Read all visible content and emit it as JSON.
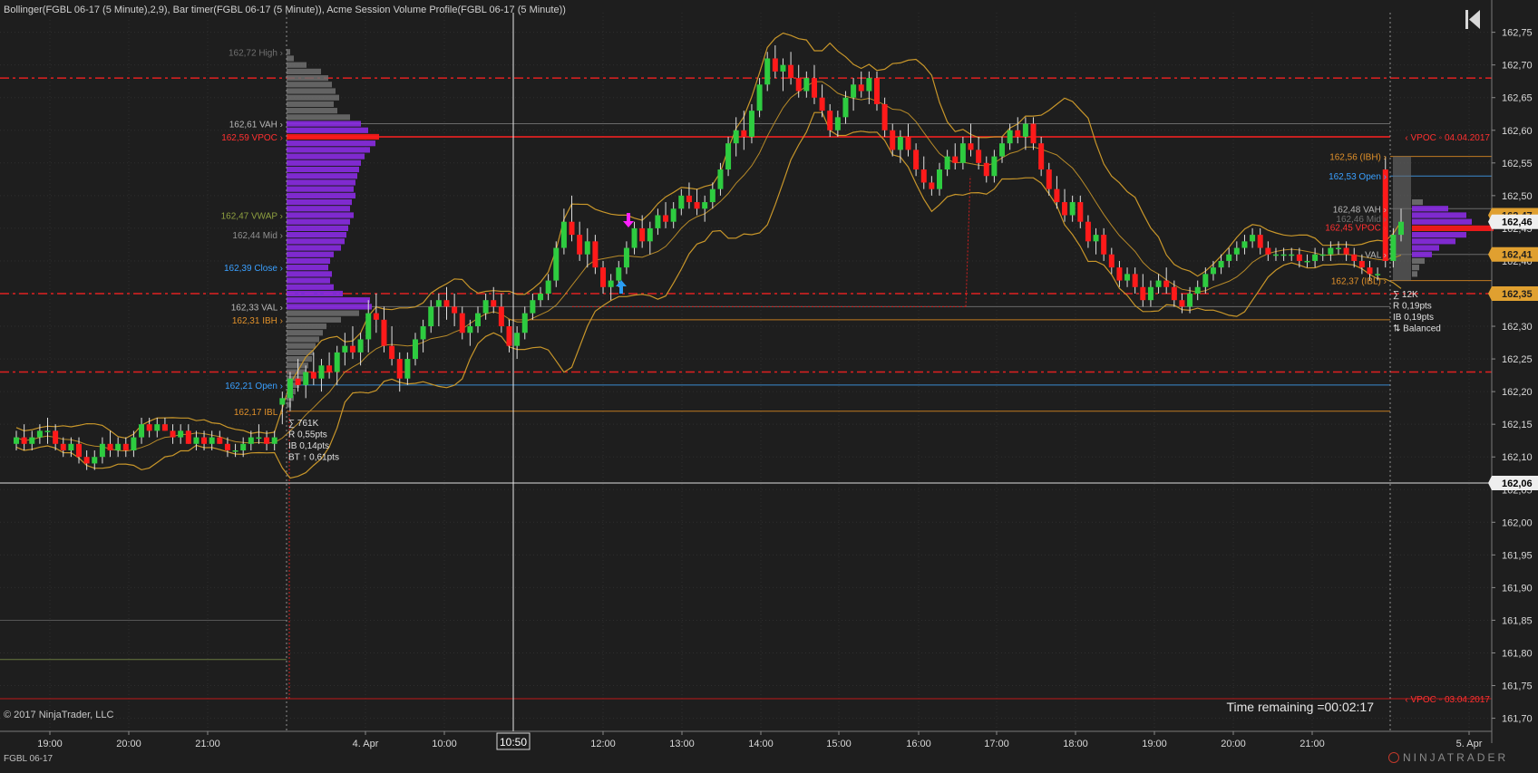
{
  "header": {
    "indicators_label": "Bollinger(FGBL 06-17 (5 Minute),2,9), Bar timer(FGBL 06-17 (5 Minute)), Acme Session Volume Profile(FGBL 06-17 (5 Minute))"
  },
  "status_bar": {
    "instrument": "FGBL 06-17",
    "brand": "NINJATRADER"
  },
  "copyright": "© 2017 NinjaTrader, LLC",
  "timer": "Time remaining =00:02:17",
  "colors": {
    "background": "#1e1e1e",
    "up": "#2ecc40",
    "down": "#ff1a1a",
    "band": "#c8962a",
    "profile": "#8a2be2",
    "poc": "#ff1a1a",
    "open": "#3aa0ff",
    "ib": "#e0902a",
    "vwap": "#8fa040"
  },
  "chart_data": {
    "type": "candlestick",
    "instrument": "FGBL 06-17",
    "timeframe": "5 Minute",
    "y_axis": {
      "min": 161.68,
      "max": 162.78,
      "ticks": [
        "162,75",
        "162,70",
        "162,65",
        "162,60",
        "162,55",
        "162,50",
        "162,45",
        "162,40",
        "162,35",
        "162,30",
        "162,25",
        "162,20",
        "162,15",
        "162,10",
        "162,05",
        "162,00",
        "161,95",
        "161,90",
        "161,85",
        "161,80",
        "161,75",
        "161,70"
      ]
    },
    "x_axis": {
      "labels": [
        "19:00",
        "20:00",
        "21:00",
        "4. Apr",
        "10:00",
        "12:00",
        "13:00",
        "14:00",
        "15:00",
        "16:00",
        "17:00",
        "18:00",
        "19:00",
        "20:00",
        "21:00",
        "5. Apr"
      ],
      "crosshair_label": "10:50"
    },
    "price_badges": [
      {
        "value": "162,47",
        "price": 162.47,
        "color": "#e0a030",
        "text_color": "#1e1e1e"
      },
      {
        "value": "162,46",
        "price": 162.46,
        "color": "#eeeeee",
        "text_color": "#000000"
      },
      {
        "value": "162,41",
        "price": 162.41,
        "color": "#e0a030",
        "text_color": "#1e1e1e"
      },
      {
        "value": "162,35",
        "price": 162.35,
        "color": "#e0a030",
        "text_color": "#1e1e1e"
      },
      {
        "value": "162,06",
        "price": 162.06,
        "color": "#eeeeee",
        "text_color": "#000000"
      }
    ],
    "profile_labels_prev": [
      {
        "text": "162,72 High",
        "price": 162.72,
        "color": "#707070"
      },
      {
        "text": "162,61 VAH",
        "price": 162.61,
        "color": "#b8b8b8"
      },
      {
        "text": "162,59 VPOC",
        "price": 162.59,
        "color": "#ff3030"
      },
      {
        "text": "162,47 VWAP",
        "price": 162.47,
        "color": "#8fa040"
      },
      {
        "text": "162,44 Mid",
        "price": 162.44,
        "color": "#909090"
      },
      {
        "text": "162,39 Close",
        "price": 162.39,
        "color": "#3aa0ff"
      },
      {
        "text": "162,33 VAL",
        "price": 162.33,
        "color": "#b8b8b8"
      },
      {
        "text": "162,31 IBH",
        "price": 162.31,
        "color": "#e0902a"
      },
      {
        "text": "162,21 Open",
        "price": 162.21,
        "color": "#3aa0ff"
      },
      {
        "text": "162,17 IBL",
        "price": 162.17,
        "color": "#e0902a"
      }
    ],
    "profile_labels_cur": [
      {
        "text": "162,56 (IBH)",
        "price": 162.56,
        "color": "#e0902a"
      },
      {
        "text": "162,53 Open",
        "price": 162.53,
        "color": "#3aa0ff"
      },
      {
        "text": "162,48 VAH",
        "price": 162.48,
        "color": "#b8b8b8"
      },
      {
        "text": "162,46 Mid",
        "price": 162.465,
        "color": "#707070"
      },
      {
        "text": "162,45 VPOC",
        "price": 162.452,
        "color": "#ff3030"
      },
      {
        "text": "VAL",
        "price": 162.41,
        "color": "#b8b8b8"
      },
      {
        "text": "162,37 (IBL)",
        "price": 162.37,
        "color": "#e0902a"
      }
    ],
    "vpoc_labels": [
      {
        "text": "‹ VPOC ◦ 04.04.2017",
        "price": 162.59
      },
      {
        "text": "‹ VPOC ◦ 03.04.2017",
        "price": 161.73
      }
    ],
    "session_stats_prev": [
      "∑ 761K",
      "R 0,55pts",
      "IB 0,14pts",
      "BT ↑ 0,61pts"
    ],
    "session_stats_cur": [
      "∑ 12K",
      "R 0,19pts",
      "IB 0,19pts",
      "⇅ Balanced"
    ],
    "dashed_levels": [
      162.68,
      162.35,
      162.23
    ],
    "candles": [
      [
        162.12,
        162.14,
        162.11,
        162.13
      ],
      [
        162.13,
        162.15,
        162.11,
        162.12
      ],
      [
        162.12,
        162.14,
        162.11,
        162.13
      ],
      [
        162.13,
        162.15,
        162.12,
        162.14
      ],
      [
        162.14,
        162.16,
        162.12,
        162.14
      ],
      [
        162.14,
        162.15,
        162.11,
        162.12
      ],
      [
        162.12,
        162.13,
        162.1,
        162.11
      ],
      [
        162.11,
        162.13,
        162.1,
        162.12
      ],
      [
        162.12,
        162.13,
        162.09,
        162.1
      ],
      [
        162.1,
        162.11,
        162.08,
        162.09
      ],
      [
        162.09,
        162.11,
        162.08,
        162.1
      ],
      [
        162.1,
        162.13,
        162.09,
        162.12
      ],
      [
        162.12,
        162.14,
        162.1,
        162.11
      ],
      [
        162.11,
        162.13,
        162.1,
        162.12
      ],
      [
        162.12,
        162.13,
        162.1,
        162.11
      ],
      [
        162.11,
        162.14,
        162.1,
        162.13
      ],
      [
        162.13,
        162.16,
        162.12,
        162.15
      ],
      [
        162.15,
        162.16,
        162.13,
        162.14
      ],
      [
        162.14,
        162.16,
        162.13,
        162.15
      ],
      [
        162.15,
        162.16,
        162.14,
        162.14
      ],
      [
        162.14,
        162.15,
        162.12,
        162.13
      ],
      [
        162.13,
        162.15,
        162.12,
        162.14
      ],
      [
        162.14,
        162.15,
        162.12,
        162.12
      ],
      [
        162.12,
        162.14,
        162.11,
        162.13
      ],
      [
        162.13,
        162.14,
        162.11,
        162.12
      ],
      [
        162.12,
        162.14,
        162.11,
        162.13
      ],
      [
        162.13,
        162.14,
        162.12,
        162.12
      ],
      [
        162.12,
        162.13,
        162.1,
        162.11
      ],
      [
        162.11,
        162.12,
        162.1,
        162.11
      ],
      [
        162.11,
        162.13,
        162.1,
        162.12
      ],
      [
        162.12,
        162.14,
        162.11,
        162.13
      ],
      [
        162.13,
        162.15,
        162.12,
        162.13
      ],
      [
        162.13,
        162.14,
        162.11,
        162.12
      ],
      [
        162.12,
        162.14,
        162.11,
        162.13
      ],
      [
        162.18,
        162.2,
        162.15,
        162.19
      ],
      [
        162.19,
        162.23,
        162.17,
        162.22
      ],
      [
        162.22,
        162.25,
        162.2,
        162.21
      ],
      [
        162.21,
        162.24,
        162.19,
        162.23
      ],
      [
        162.23,
        162.26,
        162.21,
        162.22
      ],
      [
        162.22,
        162.25,
        162.2,
        162.24
      ],
      [
        162.24,
        162.26,
        162.22,
        162.23
      ],
      [
        162.23,
        162.27,
        162.21,
        162.26
      ],
      [
        162.26,
        162.29,
        162.24,
        162.27
      ],
      [
        162.27,
        162.3,
        162.25,
        162.26
      ],
      [
        162.26,
        162.29,
        162.24,
        162.28
      ],
      [
        162.28,
        162.34,
        162.26,
        162.32
      ],
      [
        162.32,
        162.35,
        162.29,
        162.31
      ],
      [
        162.31,
        162.33,
        162.26,
        162.27
      ],
      [
        162.27,
        162.3,
        162.24,
        162.25
      ],
      [
        162.25,
        162.26,
        162.2,
        162.22
      ],
      [
        162.22,
        162.26,
        162.21,
        162.25
      ],
      [
        162.25,
        162.29,
        162.24,
        162.28
      ],
      [
        162.28,
        162.31,
        162.26,
        162.3
      ],
      [
        162.3,
        162.34,
        162.29,
        162.33
      ],
      [
        162.33,
        162.35,
        162.3,
        162.34
      ],
      [
        162.34,
        162.36,
        162.31,
        162.33
      ],
      [
        162.33,
        162.35,
        162.3,
        162.32
      ],
      [
        162.32,
        162.33,
        162.28,
        162.29
      ],
      [
        162.29,
        162.31,
        162.27,
        162.3
      ],
      [
        162.3,
        162.33,
        162.29,
        162.32
      ],
      [
        162.32,
        162.35,
        162.31,
        162.34
      ],
      [
        162.34,
        162.36,
        162.32,
        162.33
      ],
      [
        162.33,
        162.35,
        162.29,
        162.3
      ],
      [
        162.3,
        162.31,
        162.26,
        162.27
      ],
      [
        162.27,
        162.3,
        162.25,
        162.29
      ],
      [
        162.29,
        162.33,
        162.28,
        162.32
      ],
      [
        162.32,
        162.35,
        162.31,
        162.34
      ],
      [
        162.34,
        162.36,
        162.33,
        162.35
      ],
      [
        162.35,
        162.38,
        162.34,
        162.37
      ],
      [
        162.37,
        162.43,
        162.36,
        162.42
      ],
      [
        162.42,
        162.48,
        162.41,
        162.46
      ],
      [
        162.46,
        162.5,
        162.43,
        162.44
      ],
      [
        162.44,
        162.46,
        162.4,
        162.41
      ],
      [
        162.41,
        162.45,
        162.39,
        162.43
      ],
      [
        162.43,
        162.44,
        162.38,
        162.39
      ],
      [
        162.39,
        162.4,
        162.35,
        162.36
      ],
      [
        162.36,
        162.38,
        162.34,
        162.37
      ],
      [
        162.37,
        162.4,
        162.36,
        162.39
      ],
      [
        162.39,
        162.43,
        162.38,
        162.42
      ],
      [
        162.42,
        162.46,
        162.41,
        162.45
      ],
      [
        162.45,
        162.47,
        162.42,
        162.43
      ],
      [
        162.43,
        162.46,
        162.41,
        162.45
      ],
      [
        162.45,
        162.48,
        162.44,
        162.47
      ],
      [
        162.47,
        162.49,
        162.45,
        162.46
      ],
      [
        162.46,
        162.49,
        162.45,
        162.48
      ],
      [
        162.48,
        162.51,
        162.47,
        162.5
      ],
      [
        162.5,
        162.52,
        162.48,
        162.49
      ],
      [
        162.49,
        162.51,
        162.47,
        162.48
      ],
      [
        162.48,
        162.5,
        162.46,
        162.49
      ],
      [
        162.49,
        162.52,
        162.48,
        162.51
      ],
      [
        162.51,
        162.55,
        162.5,
        162.54
      ],
      [
        162.54,
        162.59,
        162.53,
        162.58
      ],
      [
        162.58,
        162.62,
        162.56,
        162.6
      ],
      [
        162.6,
        162.63,
        162.57,
        162.59
      ],
      [
        162.59,
        162.64,
        162.58,
        162.63
      ],
      [
        162.63,
        162.68,
        162.62,
        162.67
      ],
      [
        162.67,
        162.72,
        162.66,
        162.71
      ],
      [
        162.71,
        162.73,
        162.68,
        162.69
      ],
      [
        162.69,
        162.71,
        162.66,
        162.7
      ],
      [
        162.7,
        162.72,
        162.67,
        162.68
      ],
      [
        162.68,
        162.7,
        162.65,
        162.66
      ],
      [
        162.66,
        162.69,
        162.65,
        162.68
      ],
      [
        162.68,
        162.7,
        162.64,
        162.65
      ],
      [
        162.65,
        162.67,
        162.62,
        162.63
      ],
      [
        162.63,
        162.64,
        162.59,
        162.6
      ],
      [
        162.6,
        162.63,
        162.59,
        162.62
      ],
      [
        162.62,
        162.66,
        162.61,
        162.65
      ],
      [
        162.65,
        162.68,
        162.63,
        162.67
      ],
      [
        162.67,
        162.69,
        162.65,
        162.66
      ],
      [
        162.66,
        162.69,
        162.64,
        162.68
      ],
      [
        162.68,
        162.69,
        162.63,
        162.64
      ],
      [
        162.64,
        162.65,
        162.59,
        162.6
      ],
      [
        162.6,
        162.61,
        162.56,
        162.57
      ],
      [
        162.57,
        162.6,
        162.55,
        162.59
      ],
      [
        162.59,
        162.61,
        162.56,
        162.57
      ],
      [
        162.57,
        162.58,
        162.53,
        162.54
      ],
      [
        162.54,
        162.56,
        162.51,
        162.52
      ],
      [
        162.52,
        162.53,
        162.5,
        162.51
      ],
      [
        162.51,
        162.55,
        162.5,
        162.54
      ],
      [
        162.54,
        162.57,
        162.53,
        162.56
      ],
      [
        162.56,
        162.58,
        162.54,
        162.55
      ],
      [
        162.55,
        162.59,
        162.54,
        162.58
      ],
      [
        162.58,
        162.61,
        162.56,
        162.57
      ],
      [
        162.57,
        162.59,
        162.54,
        162.55
      ],
      [
        162.55,
        162.56,
        162.52,
        162.53
      ],
      [
        162.53,
        162.57,
        162.52,
        162.56
      ],
      [
        162.56,
        162.59,
        162.55,
        162.58
      ],
      [
        162.58,
        162.61,
        162.57,
        162.6
      ],
      [
        162.6,
        162.62,
        162.58,
        162.59
      ],
      [
        162.59,
        162.62,
        162.57,
        162.61
      ],
      [
        162.61,
        162.62,
        162.57,
        162.58
      ],
      [
        162.58,
        162.59,
        162.53,
        162.54
      ],
      [
        162.54,
        162.55,
        162.5,
        162.51
      ],
      [
        162.51,
        162.53,
        162.48,
        162.49
      ],
      [
        162.49,
        162.51,
        162.46,
        162.47
      ],
      [
        162.47,
        162.5,
        162.46,
        162.49
      ],
      [
        162.49,
        162.5,
        162.45,
        162.46
      ],
      [
        162.46,
        162.47,
        162.42,
        162.43
      ],
      [
        162.43,
        162.45,
        162.41,
        162.44
      ],
      [
        162.44,
        162.45,
        162.4,
        162.41
      ],
      [
        162.41,
        162.42,
        162.38,
        162.39
      ],
      [
        162.39,
        162.4,
        162.36,
        162.37
      ],
      [
        162.37,
        162.39,
        162.36,
        162.38
      ],
      [
        162.38,
        162.39,
        162.35,
        162.36
      ],
      [
        162.36,
        162.38,
        162.33,
        162.34
      ],
      [
        162.34,
        162.37,
        162.33,
        162.36
      ],
      [
        162.36,
        162.38,
        162.35,
        162.37
      ],
      [
        162.37,
        162.39,
        162.35,
        162.36
      ],
      [
        162.36,
        162.37,
        162.33,
        162.34
      ],
      [
        162.34,
        162.35,
        162.32,
        162.33
      ],
      [
        162.33,
        162.36,
        162.32,
        162.35
      ],
      [
        162.35,
        162.37,
        162.34,
        162.36
      ],
      [
        162.36,
        162.39,
        162.35,
        162.38
      ],
      [
        162.38,
        162.4,
        162.37,
        162.39
      ],
      [
        162.39,
        162.41,
        162.38,
        162.4
      ],
      [
        162.4,
        162.42,
        162.39,
        162.41
      ],
      [
        162.41,
        162.43,
        162.4,
        162.42
      ],
      [
        162.42,
        162.44,
        162.41,
        162.43
      ],
      [
        162.43,
        162.45,
        162.42,
        162.44
      ],
      [
        162.44,
        162.45,
        162.41,
        162.42
      ],
      [
        162.42,
        162.43,
        162.4,
        162.41
      ],
      [
        162.41,
        162.42,
        162.4,
        162.41
      ],
      [
        162.41,
        162.42,
        162.4,
        162.41
      ],
      [
        162.41,
        162.42,
        162.4,
        162.41
      ],
      [
        162.41,
        162.42,
        162.39,
        162.4
      ],
      [
        162.4,
        162.41,
        162.39,
        162.4
      ],
      [
        162.4,
        162.42,
        162.39,
        162.41
      ],
      [
        162.41,
        162.42,
        162.4,
        162.41
      ],
      [
        162.41,
        162.43,
        162.4,
        162.42
      ],
      [
        162.42,
        162.43,
        162.41,
        162.42
      ],
      [
        162.42,
        162.43,
        162.4,
        162.41
      ],
      [
        162.41,
        162.42,
        162.39,
        162.4
      ],
      [
        162.4,
        162.41,
        162.38,
        162.39
      ],
      [
        162.39,
        162.4,
        162.37,
        162.38
      ],
      [
        162.38,
        162.39,
        162.37,
        162.38
      ],
      [
        162.54,
        162.56,
        162.39,
        162.4
      ],
      [
        162.4,
        162.45,
        162.39,
        162.44
      ],
      [
        162.44,
        162.48,
        162.43,
        162.46
      ]
    ]
  }
}
